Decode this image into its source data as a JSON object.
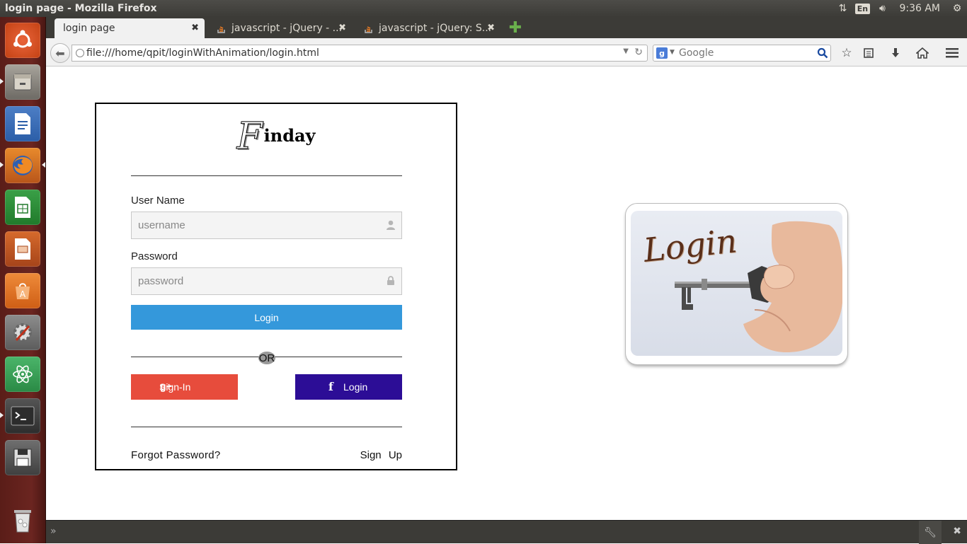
{
  "system": {
    "window_title": "login page - Mozilla Firefox",
    "keyboard_layout": "En",
    "clock": "9:36 AM"
  },
  "browser": {
    "tabs": [
      {
        "label": "login page"
      },
      {
        "label": "javascript - jQuery - ..."
      },
      {
        "label": "javascript - jQuery: S..."
      }
    ],
    "url": "file:///home/qpit/loginWithAnimation/login.html",
    "search_placeholder": "Google",
    "search_engine_letter": "g"
  },
  "login": {
    "brand_initial": "F",
    "brand_rest": "inday",
    "username_label": "User Name",
    "username_placeholder": "username",
    "password_label": "Password",
    "password_placeholder": "password",
    "login_button": "Login",
    "or_text": "OR",
    "google_button": "Sign-In",
    "facebook_button": "Login",
    "forgot_password": "Forgot Password?",
    "sign_up": "Sign Up"
  },
  "promo_image": {
    "text": "Login"
  },
  "colors": {
    "login_blue": "#3498db",
    "google_red": "#e74c3c",
    "facebook_purple": "#2c0d96"
  }
}
